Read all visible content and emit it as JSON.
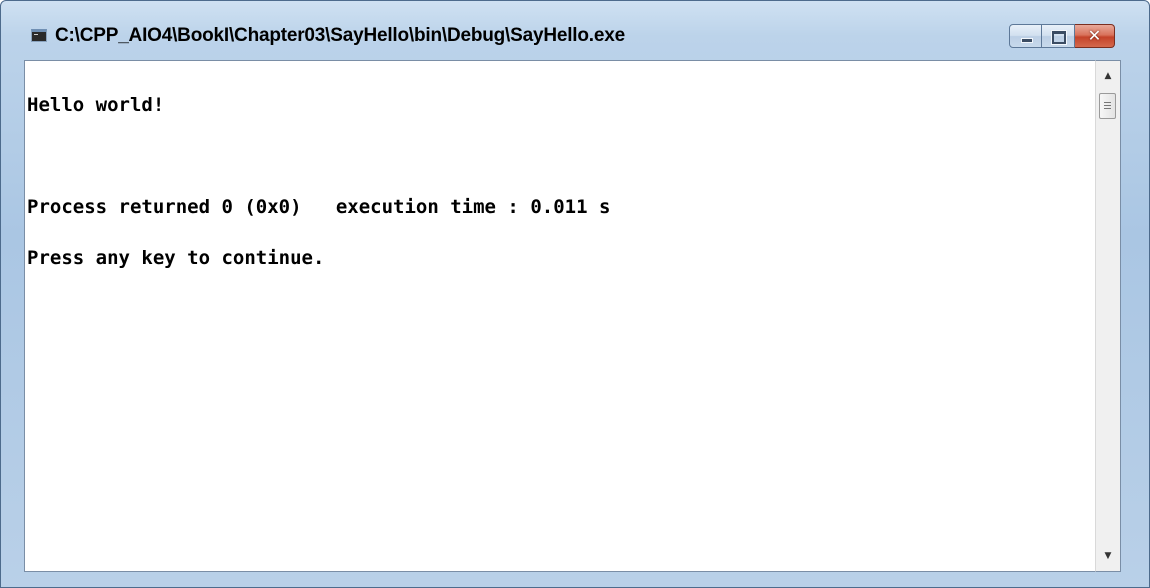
{
  "window": {
    "title": "C:\\CPP_AIO4\\BookI\\Chapter03\\SayHello\\bin\\Debug\\SayHello.exe",
    "icon": "console-app-icon",
    "caption_buttons": {
      "minimize_icon": "minimize-icon",
      "maximize_icon": "maximize-icon",
      "close_glyph": "✕",
      "close_color": "#c4432a"
    }
  },
  "console": {
    "background_color": "#ffffff",
    "text_color": "#000000",
    "lines": [
      "Hello world!",
      "",
      "Process returned 0 (0x0)   execution time : 0.011 s",
      "Press any key to continue."
    ]
  },
  "scrollbar": {
    "up_arrow": "▲",
    "down_arrow": "▼"
  }
}
